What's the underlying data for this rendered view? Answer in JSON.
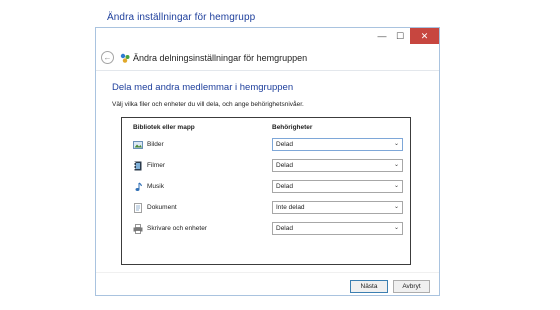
{
  "page": {
    "heading": "Ändra inställningar för hemgrupp"
  },
  "window": {
    "controls": {
      "minimize": "—",
      "maximize": "☐",
      "close": "✕"
    },
    "nav": {
      "back_icon": "arrow-left-icon",
      "title": "Ändra delningsinställningar för hemgruppen"
    },
    "content": {
      "title": "Dela med andra medlemmar i hemgruppen",
      "description": "Välj vilka filer och enheter du vill dela, och ange behörighetsnivåer."
    },
    "table": {
      "headers": {
        "library": "Bibliotek eller mapp",
        "permissions": "Behörigheter"
      },
      "rows": [
        {
          "label": "Bilder",
          "permission": "Delad",
          "icon": "pictures-icon"
        },
        {
          "label": "Filmer",
          "permission": "Delad",
          "icon": "videos-icon"
        },
        {
          "label": "Musik",
          "permission": "Delad",
          "icon": "music-icon"
        },
        {
          "label": "Dokument",
          "permission": "Inte delad",
          "icon": "documents-icon"
        },
        {
          "label": "Skrivare och enheter",
          "permission": "Delad",
          "icon": "printer-icon"
        }
      ]
    },
    "buttons": {
      "next": "Nästa",
      "cancel": "Avbryt"
    }
  }
}
